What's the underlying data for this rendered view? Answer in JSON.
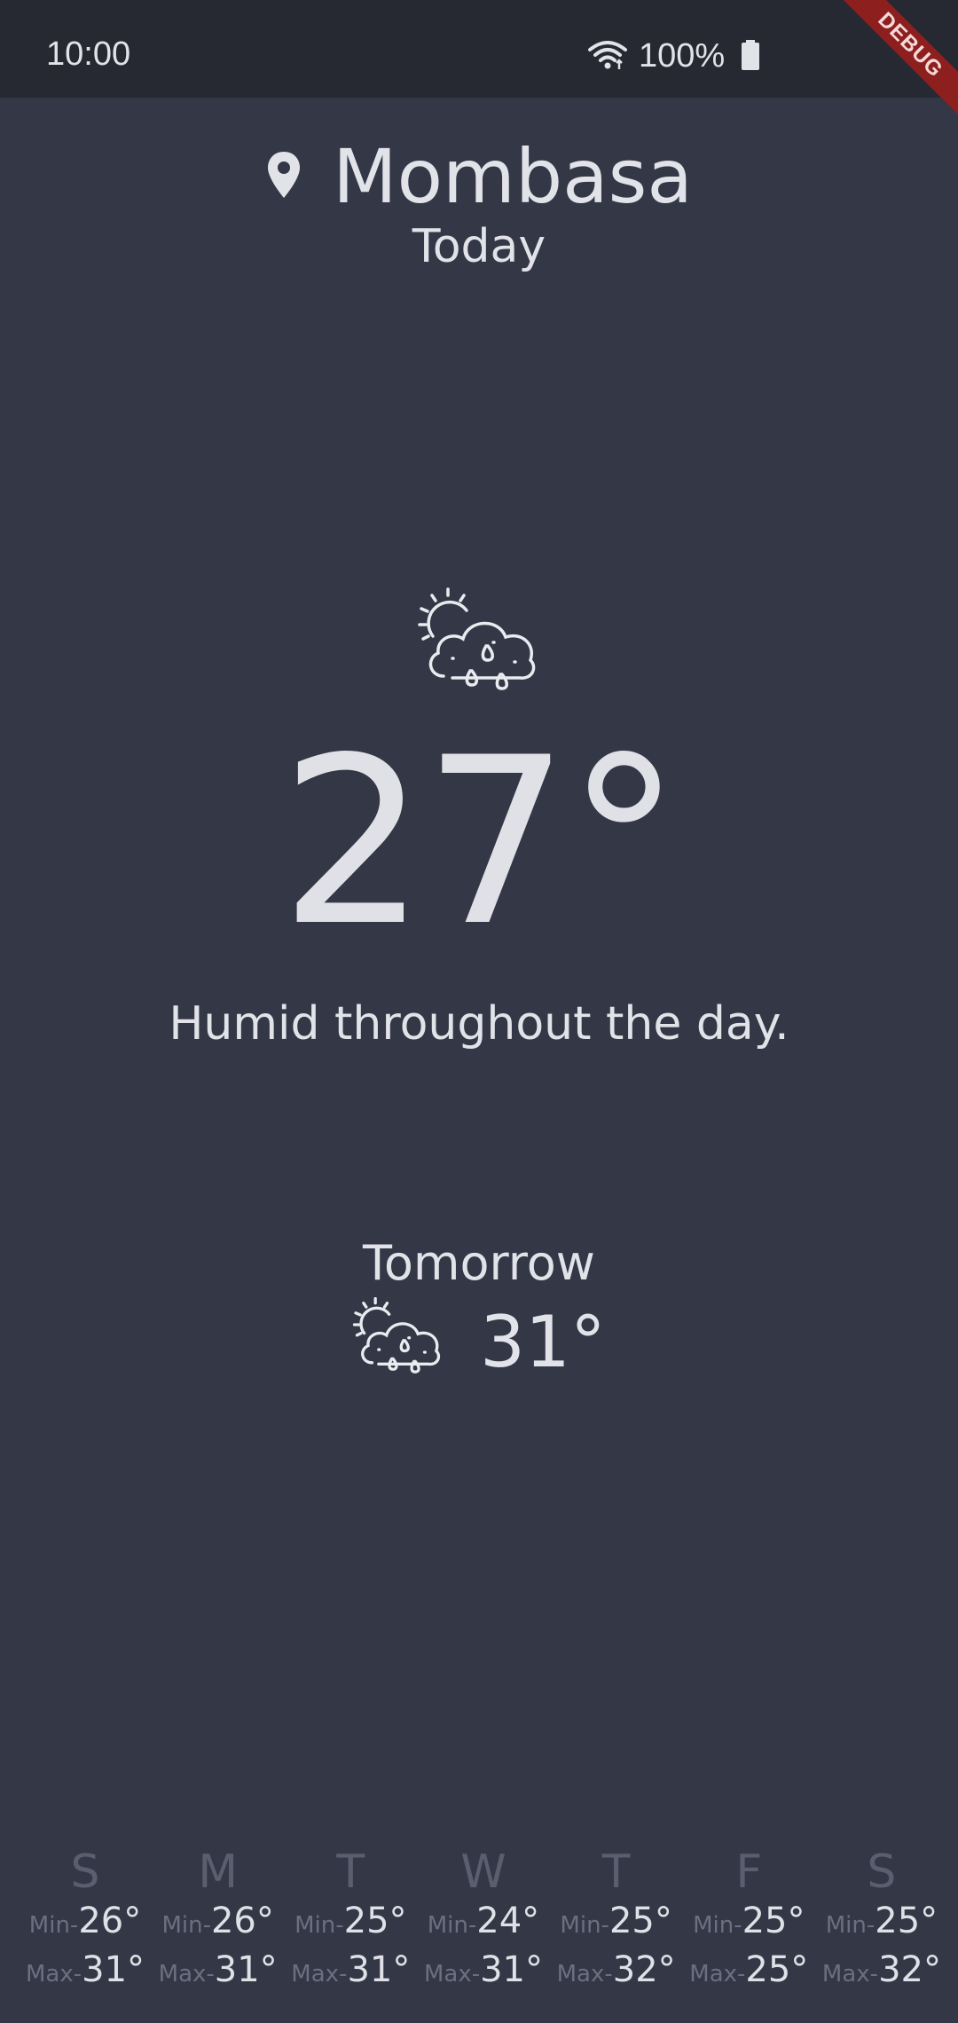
{
  "status_bar": {
    "time": "10:00",
    "battery": "100%",
    "wifi_icon": "wifi-icon",
    "battery_icon": "battery-icon"
  },
  "debug_banner": "DEBUG",
  "location": {
    "icon": "location-pin-icon",
    "city": "Mombasa",
    "day_label": "Today"
  },
  "current": {
    "icon": "sun-cloud-rain-icon",
    "temperature": "27°",
    "summary": "Humid throughout the day."
  },
  "tomorrow": {
    "label": "Tomorrow",
    "icon": "sun-cloud-rain-icon",
    "temperature": "31°"
  },
  "week": {
    "min_label": "Min-",
    "max_label": "Max-",
    "days": [
      {
        "letter": "S",
        "min": "26°",
        "max": "31°"
      },
      {
        "letter": "M",
        "min": "26°",
        "max": "31°"
      },
      {
        "letter": "T",
        "min": "25°",
        "max": "31°"
      },
      {
        "letter": "W",
        "min": "24°",
        "max": "31°"
      },
      {
        "letter": "T",
        "min": "25°",
        "max": "32°"
      },
      {
        "letter": "F",
        "min": "25°",
        "max": "25°"
      },
      {
        "letter": "S",
        "min": "25°",
        "max": "32°"
      }
    ]
  },
  "colors": {
    "background": "#333746",
    "status_bar": "#262931",
    "text": "#e1e3e9",
    "muted": "#5a5f6f",
    "debug": "#8e1f1f"
  }
}
